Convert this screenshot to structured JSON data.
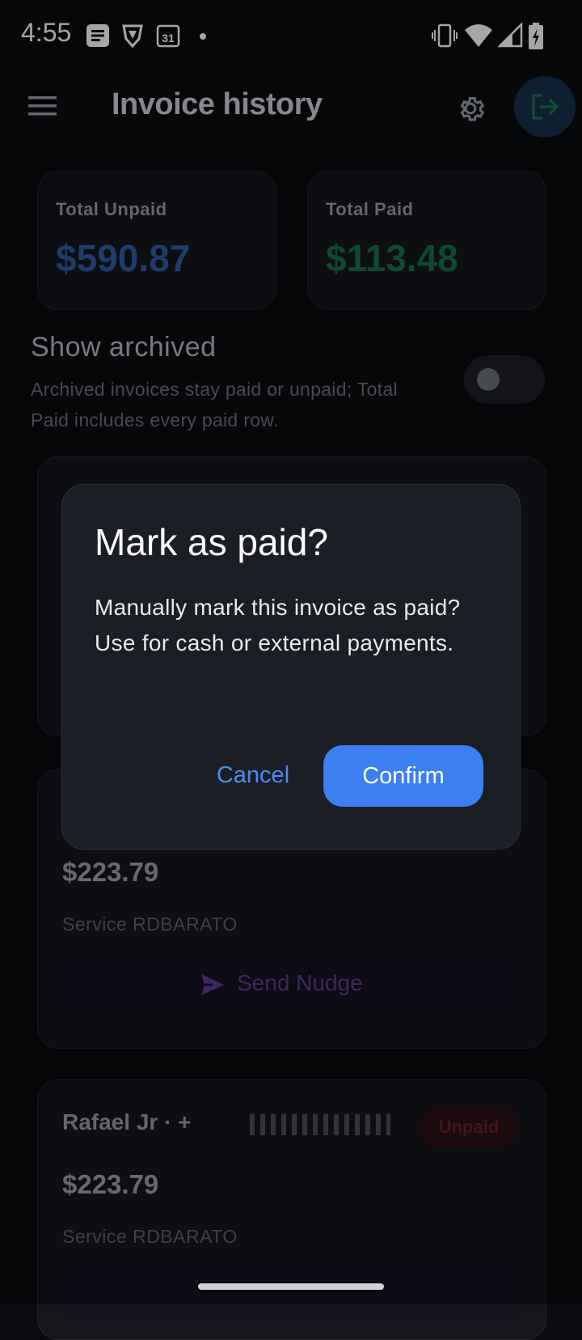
{
  "status_bar": {
    "time": "4:55"
  },
  "app_bar": {
    "title": "Invoice history"
  },
  "summary": {
    "unpaid_label": "Total Unpaid",
    "unpaid_value": "$590.87",
    "paid_label": "Total Paid",
    "paid_value": "$113.48",
    "unpaid_color": "#2f5ea8",
    "paid_color": "#17704a"
  },
  "archive_toggle": {
    "title": "Show archived",
    "subtitle": "Archived invoices stay paid or unpaid; Total Paid includes every paid row.",
    "checked": false
  },
  "invoices": [
    {
      "amount": "$223.79",
      "service": "Service RDBARATO",
      "nudge_label": "Send Nudge"
    },
    {
      "name": "Rafael Jr · +",
      "status": "Unpaid",
      "amount": "$223.79",
      "service": "Service RDBARATO"
    }
  ],
  "dialog": {
    "title": "Mark as paid?",
    "body": "Manually mark this invoice as paid? Use for cash or external payments.",
    "cancel": "Cancel",
    "confirm": "Confirm"
  },
  "icons": [
    "menu-icon",
    "settings-gear-icon",
    "logout-icon",
    "send-icon",
    "message-icon",
    "vpn-shield-icon",
    "calendar-icon",
    "vibrate-icon",
    "wifi-icon",
    "signal-icon",
    "battery-charging-icon"
  ]
}
